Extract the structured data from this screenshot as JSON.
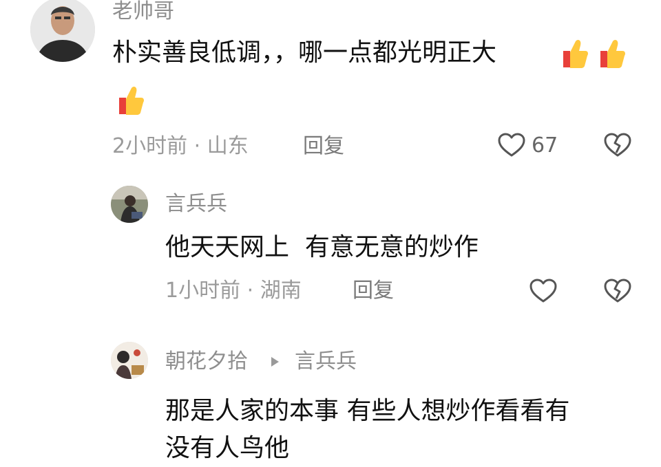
{
  "comments": [
    {
      "author": "老帅哥",
      "text_line1": "朴实善良低调，，哪一点都光明正大",
      "emojis": [
        "thumbs-up-emoji",
        "thumbs-up-emoji",
        "thumbs-up-emoji"
      ],
      "time_location": "2小时前 · 山东",
      "reply_label": "回复",
      "like_count": "67"
    },
    {
      "author": "言兵兵",
      "text": "他天天网上  有意无意的炒作",
      "time_location": "1小时前 · 湖南",
      "reply_label": "回复"
    },
    {
      "author": "朝花夕拾",
      "reply_to": "言兵兵",
      "text_line1": "那是人家的本事 有些人想炒作看看有",
      "text_line2": "没有人鸟他"
    }
  ],
  "icons": {
    "like": "heart-outline-icon",
    "dislike": "broken-heart-icon",
    "reply_arrow": "triangle-right-icon"
  },
  "colors": {
    "name": "#8e8e8e",
    "meta": "#9a9a9a",
    "text": "#111111",
    "icon": "#555555"
  }
}
